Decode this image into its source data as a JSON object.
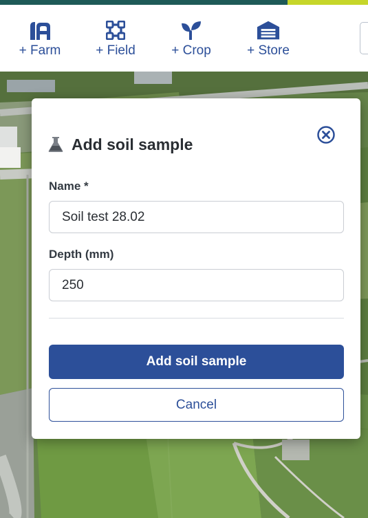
{
  "toolbar": {
    "items": [
      {
        "label": "+ Farm",
        "icon": "farm-icon"
      },
      {
        "label": "+ Field",
        "icon": "field-icon"
      },
      {
        "label": "+ Crop",
        "icon": "crop-sprout-icon"
      },
      {
        "label": "+ Store",
        "icon": "store-barn-icon"
      }
    ]
  },
  "modal": {
    "title": "Add soil sample",
    "title_icon": "flask-icon",
    "close_icon": "close-circle-icon",
    "fields": {
      "name": {
        "label": "Name *",
        "value": "Soil test 28.02"
      },
      "depth": {
        "label": "Depth (mm)",
        "value": "250"
      }
    },
    "submit_label": "Add soil sample",
    "cancel_label": "Cancel"
  },
  "colors": {
    "primary": "#2c4f99",
    "accent_dark": "#1e5a57",
    "accent_lime": "#c6d62a"
  }
}
